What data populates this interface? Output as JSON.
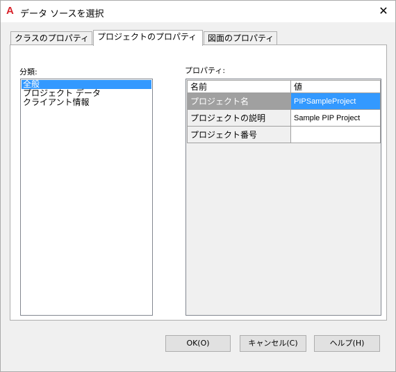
{
  "window": {
    "title": "データ ソースを選択",
    "app_icon": "A",
    "close_glyph": "✕"
  },
  "tabs": [
    {
      "label": "クラスのプロパティ"
    },
    {
      "label": "プロジェクトのプロパティ"
    },
    {
      "label": "図面のプロパティ"
    }
  ],
  "categories": {
    "label": "分類:",
    "items": [
      {
        "label": "全般"
      },
      {
        "label": "プロジェクト データ"
      },
      {
        "label": "クライアント情報"
      }
    ]
  },
  "properties": {
    "label": "プロパティ:",
    "headers": {
      "name": "名前",
      "value": "値"
    },
    "rows": [
      {
        "name": "プロジェクト名",
        "value": "PIPSampleProject"
      },
      {
        "name": "プロジェクトの説明",
        "value": "Sample PIP Project"
      },
      {
        "name": "プロジェクト番号",
        "value": ""
      }
    ]
  },
  "buttons": {
    "ok": "OK(O)",
    "cancel": "キャンセル(C)",
    "help": "ヘルプ(H)"
  },
  "colors": {
    "selection": "#3399ff",
    "app_icon": "#d8222a"
  }
}
